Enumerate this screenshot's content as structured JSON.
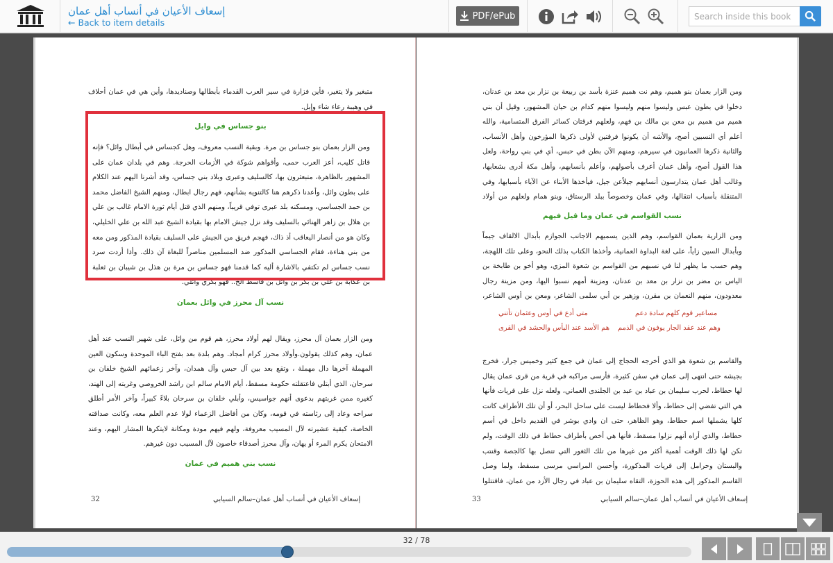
{
  "header": {
    "logo": "library-building-icon",
    "title": "إسعاف الأعيان في أنساب أهل عمان",
    "back_link": "← Back to item details",
    "pdf_label": "PDF/ePub",
    "tools": [
      "info-icon",
      "share-icon",
      "audio-icon",
      "zoom-out-icon",
      "zoom-in-icon"
    ],
    "search_placeholder": "Search inside this book"
  },
  "left_page": {
    "intro_text": "متبغير ولا يتغير، فأين فزارة في سير العرب القدماء بأبطالها وصناديدها، وأين هي في عمان أحلاف في وهيبة رعاء شاء وإبل.",
    "heading1": "بنو جساس في وايل",
    "para1": "ومن الزار بعمان بنو جساس بن مرة. وبقية النسب معروف، وهل كجساس في أبطال وائل؟ فإنه قاتل كليب، أعز العرب حمى، وأقواهم شوكة في الأزمات الحرجة. وهم في بلدان عمان على المشهور بالظاهرة، متبعثرون بها، كالسليف وعبرى وبلاد بني جساس، وقد أشرنا اليهم عند الكلام على بطون وائل، وأعدنا ذكرهم هنا كالتنويه بشأنهم، فهم رجال ابطال، ومنهم الشيخ الفاضل محمد بن حمد الجساسي، ومسكنه بلد عبرى توفي قريباً، ومنهم الذي قتل أيام ثورة الامام غالب بن علي بن هلال بن زاهر الهنائي بالسليف وقد نزل جيش الامام بها بقيادة الشيخ عبد الله بن علي الخليلي، وكان هو من أنصار اليعاقب أذ ذاك، فهجم فريق من الجيش على السليف بقيادة المذكور ومن معه من بني هناءة، فقام الجساسي المذكور ضد المسلمين مناصراً للبغاة آن ذلك. وأذا أردت سرد نسب جساس لم تكتفي بالاشارة أليه كما قدمنا فهو جساس بن مرة بن هذل بن شيبان بن ثعلبة بن عكابة بن علي بن بكر بن وائل بن قاسط الخ.. فهو بكري وائلي.",
    "heading2": "نسب آل محرز في وائل بعمان",
    "para2": "ومن الزار بعمان آل محرز، ويقال لهم أولاد محرز، هم قوم من وائل، على شهير النسب عند أهل عمان، وهم كذلك يقولون.وأولاد محرز كرام أمجاد. وهم بلدة بعد بفتح الباء الموحدة وسكون العين المهملة آخرها دال مهملة ، وتقع بعد بين آل حبس وآل همدان، وآخر زعمائهم الشيخ خلفان بن سرحان، الذي أبتلي فاعتقلته حكومة مسقط، أيام الامام سالم ابن راشد الخروصي وغربته إلى الهند، كغيره ممن غربتهم بدعوى أنهم جواسيس، وأبلي خلفان بن سرحان بلاءً كبيراً، وآخر الأمر أطلق سراحه وعاد إلى رئاسته في قومه، وكان من أفاضل الزعماء لولا عدم العلم معه، وكانت صداقته الخاصة، كبقية عشيرته لآل المسيب معروفة، ولهم فيهم مودة ومكانة لايتكرها المشار اليهم، وعند الامتحان يكرم المرء أو يهان، وآل محرز أصدقاء خاصون لآل المسيب دون غيرهم.",
    "heading3": "نسب بني هميم في عمان",
    "footer_title": "إسعاف الأعيان في أنساب أهل عمان–سالم السيابي",
    "page_number": "32"
  },
  "right_page": {
    "para1": "ومن الزار بعمان بنو هميم، وهم نت هميم عنزة بأسد بن ربيعة بن نزار بن معد بن عدنان، دخلوا في بطون عبس وليسوا منهم وليسوا منهم كدام بن حيان المشهور، وقيل أن بني هميم من هميم بن معن بن مالك بن فهم، ولعلهم فرقتان كسائر الفرق المتسامية، والله أعلم أي النسبين أصح، والأشه أن يكونوا فرقتين لأولى ذكرها المؤرخون وأهل الأنساب، والثانية ذكرها العمانيون في سيرهم، ومنهم الآن بطن في حبس، أي في بني رواحة، ولعل هذا القول أصح، وأهل عمان أعرف بأصولهم، وأعلم بأنسابهم، وأهل مكة أدرى بشعابها، وغالب أهل عمان يتدارسون أنسابهم جيلاًعن جيل، فيأخذها الأبناء عن الآباء بأسبابها، وفي المتنقلة بأسباب انتقالها، وفي عمان وخصوصاً ببلد الرستاق، وبنو همام ولعلهم من أولاد همام المشهور في وائل.",
    "heading1": "نسب القواسم في عمان وما قيل فيهم",
    "para2": "ومن الزارية بعمان القواسم، وهم الذين يسميهم الاجانب الجوازم بأبدال الالقاف جيماً وبأبدال السين زاياً، على لغة البداوة العمانية، وأخذها الكتاب بذلك النحو، وعلى تلك اللهجة، وهم حسب ما يظهر لنا في نسبهم من القواسم بن شعوة المزي، وهو أخو بن طابخة بن الياس بن مضر بن نزار بن معد بن عدنان، ومزينة أمهم نسبوا اليها، ومن مزينة رجال معدودون، منهم النعمان بن مقرن، وزهير بن أبي سلمى الشاعر، ومعن بن أوس الشاعر، وأياس بن معاوية القاضي، وفيهم يقول القايل:",
    "verse1_right": "مساعير قوم كلهم سادة دعم",
    "verse1_left": "متى أدع في أوس وعثمان تأتني",
    "verse2_right": "وهم عند عقد الجار يوفون في الذمم",
    "verse2_left": "هم الأسد عند البأس والحشد في القرى",
    "para3": "والقاسم بن شعوة هو الذي أخرجه الحجاج إلى عمان في جمع كثير وخميس جرار، فخرج بجيشه حتى انتهى إلى عمان في سفن كثيرة، فأرسى مراكبه في قرية من قرى عمان يقال لها حطاط، لحرب سليمان بن عباد بن عبد بن الجلندى العماني، ولعله نزل على قريات فأنها هي التي تفضي إلى حطاط، وألا فحطاط ليست على ساحل البحر، أو أن تلك الأطراف كانت كلها يشملها اسم حطاط، وهو الظاهر، حتى ان وادي بوشر في القديم داخل في أسم حطاط، والذي أراه أنهم نزلوا مسقط، فأنها هي أخص بأطراف حطاط في ذلك الوقت، ولم تكن لها ذلك الوقت أهمية أكثر من غيرها من تلك الثغور التي تتصل بها كالجصة وقنتب والبستان وحرامل إلى قريات المذكورة، وأحسن المراسي مرسى مسقط، ولما وصل القاسم المذكور إلى هذه الحوزة، التقاه سليمان بن عباد في رجال الأزد من عمان، فاقتتلوا قتالاً شديداً،",
    "footer_title": "إسعاف الأعيان في أنساب أهل عمان–سالم السيابي",
    "page_number": "33"
  },
  "bottom_bar": {
    "page_indicator": "32 / 78",
    "progress": 0.41,
    "nav": [
      "prev-page-icon",
      "next-page-icon"
    ],
    "views": [
      "single-page-view-icon",
      "two-page-view-icon",
      "thumbnail-view-icon"
    ]
  },
  "colors": {
    "link": "#2a8bd0",
    "heading_green": "#3a9a2a",
    "verse_red": "#c0392b",
    "highlight": "#e0303c",
    "reader_bg": "#4a4a4a",
    "search_button": "#3a8fd8",
    "slider_thumb": "#2d5f8d"
  }
}
